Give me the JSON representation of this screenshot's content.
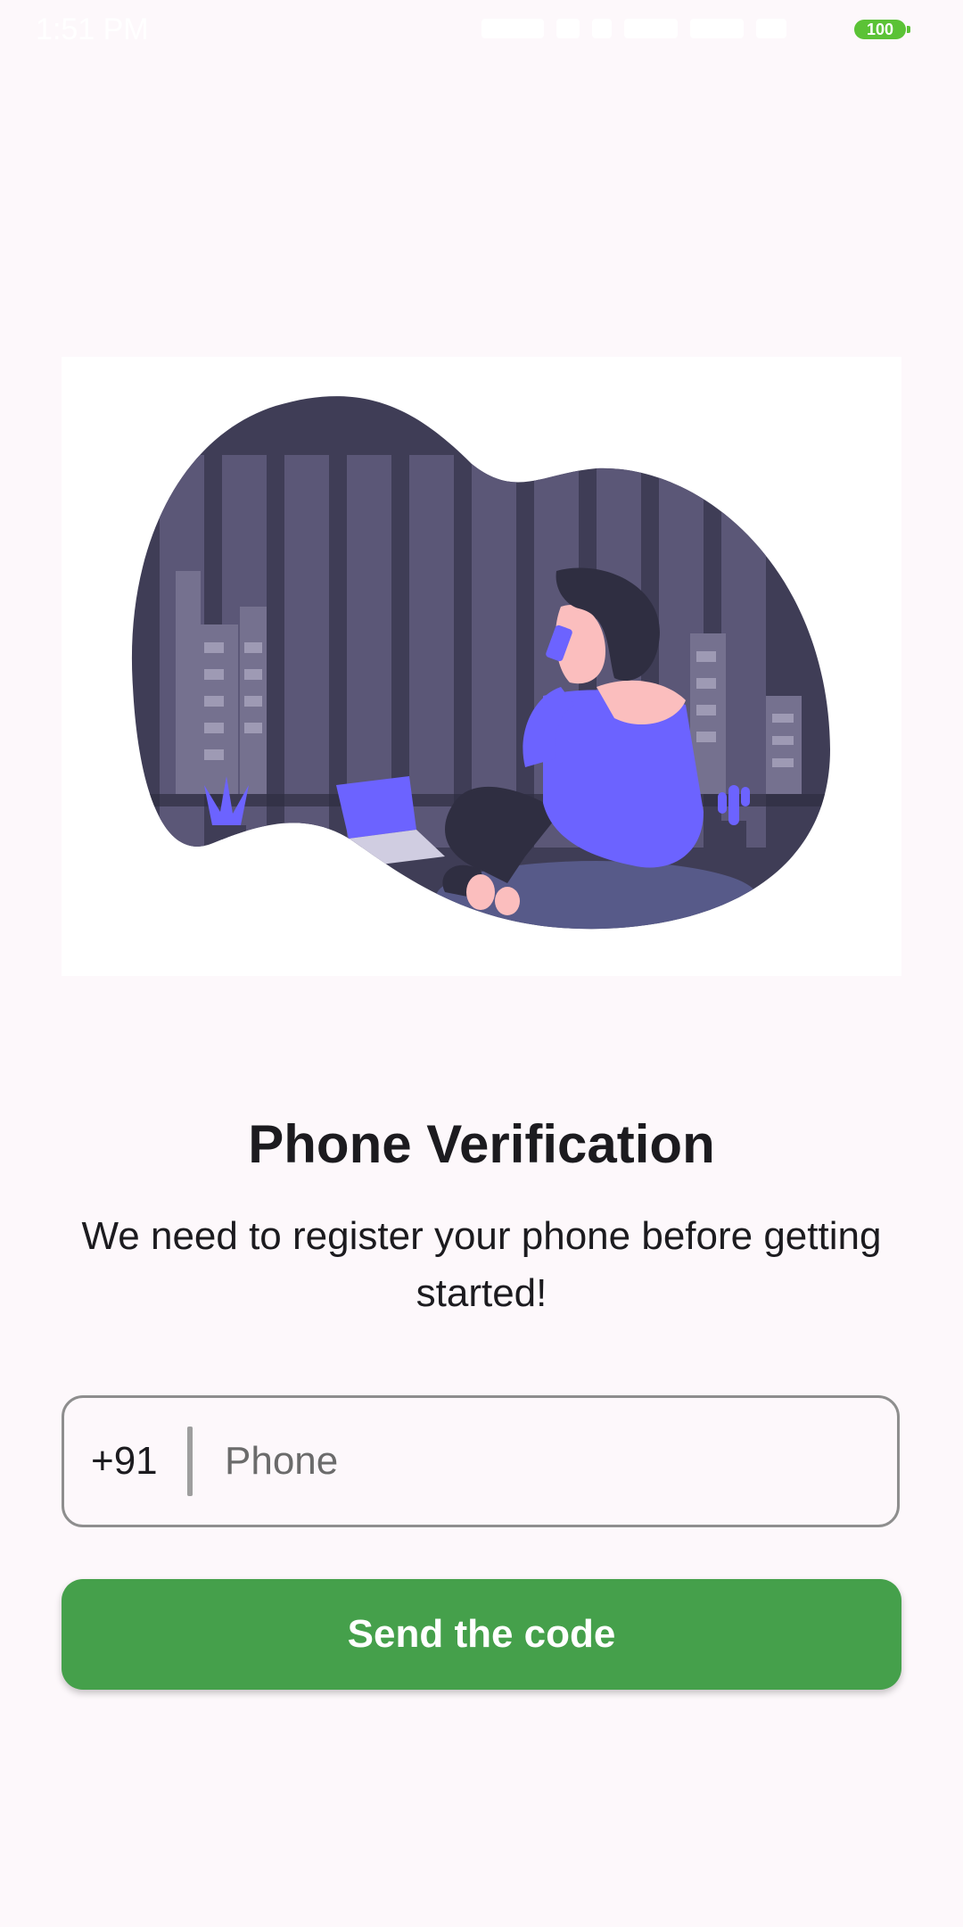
{
  "status_bar": {
    "time": "1:51 PM",
    "battery": "100"
  },
  "illustration": {
    "icon": "woman-on-phone-illustration"
  },
  "main": {
    "title": "Phone Verification",
    "subtitle": "We need to register your phone before getting started!"
  },
  "phone_form": {
    "country_code": "+91",
    "phone_placeholder": "Phone",
    "phone_value": ""
  },
  "actions": {
    "send_label": "Send the code"
  },
  "colors": {
    "background": "#fdf8fb",
    "primary_button": "#45a04b",
    "illustration_accent": "#6c63ff",
    "illustration_dark": "#3f3d56",
    "battery": "#5bc236"
  }
}
